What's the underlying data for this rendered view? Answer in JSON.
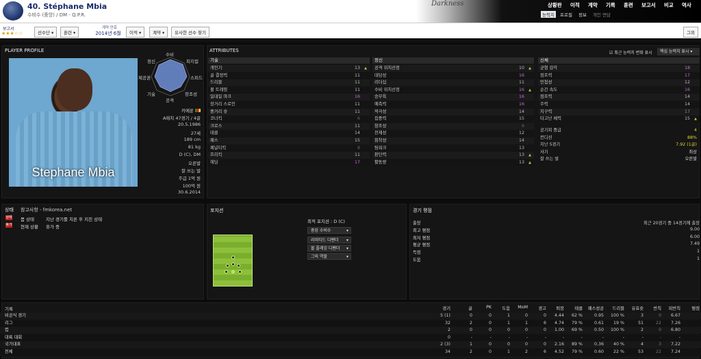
{
  "header": {
    "name": "40. Stéphane Mbia",
    "subtitle": "수비수 (중앙) / DM - Q.P.R.",
    "skin_name": "Darkness",
    "menu": [
      "상황판",
      "이적",
      "계약",
      "기록",
      "훈련",
      "보고서",
      "비교",
      "역사"
    ],
    "subtabs": [
      "능력치",
      "프로필",
      "정보",
      "개인 면담"
    ]
  },
  "toolbar": {
    "scout_label": "보고서",
    "stars": "★★★☆☆",
    "player_label": "선수단",
    "training_label": "훈련",
    "contract_label": "계약 만료",
    "contract_value": "2014년 6월",
    "transfer_label": "이적",
    "contract_btn": "계약",
    "similar_label": "유사한 선수 찾기",
    "other_label": "그외"
  },
  "profile": {
    "title": "PLAYER PROFILE",
    "photo_name": "Stephane Mbia",
    "radar_labels": [
      "수비",
      "피지컬",
      "스피드",
      "창조성",
      "공격",
      "기술",
      "제공권",
      "정신"
    ],
    "info": [
      "카메룬",
      "A매치 47경기 / 4골",
      "20.5.1986",
      "27세",
      "189 cm",
      "81 kg",
      "D (C), DM",
      "오른발",
      "잘 쓰는 발",
      "주급 1억 원",
      "100억 원",
      "30.6.2014"
    ]
  },
  "attributes": {
    "title": "ATTRIBUTES",
    "show_changes": "최근 능력치 변화 표시",
    "key_label": "핵심 능력치 표시",
    "technical": {
      "title": "기술",
      "rows": [
        [
          "개인기",
          "13",
          "▲"
        ],
        [
          "골 결정력",
          "11",
          ""
        ],
        [
          "드리블",
          "11",
          ""
        ],
        [
          "볼 트래핑",
          "11",
          ""
        ],
        [
          "일대일 마크",
          "16",
          ""
        ],
        [
          "장거리 스로인",
          "11",
          ""
        ],
        [
          "중거리 슛",
          "11",
          ""
        ],
        [
          "코너킥",
          "6",
          ""
        ],
        [
          "크로스",
          "11",
          ""
        ],
        [
          "태클",
          "14",
          ""
        ],
        [
          "패스",
          "15",
          ""
        ],
        [
          "페널티킥",
          "8",
          ""
        ],
        [
          "프리킥",
          "11",
          ""
        ],
        [
          "헤딩",
          "17",
          ""
        ]
      ]
    },
    "mental": {
      "title": "정신",
      "rows": [
        [
          "공격 위치선정",
          "10",
          "▲"
        ],
        [
          "대담성",
          "16",
          ""
        ],
        [
          "리더십",
          "11",
          ""
        ],
        [
          "수비 위치선정",
          "16",
          "▲"
        ],
        [
          "승부욕",
          "16",
          ""
        ],
        [
          "예측력",
          "16",
          ""
        ],
        [
          "적극성",
          "14",
          ""
        ],
        [
          "집중력",
          "15",
          ""
        ],
        [
          "창조성",
          "6",
          ""
        ],
        [
          "천재성",
          "12",
          ""
        ],
        [
          "침착성",
          "14",
          ""
        ],
        [
          "팀워크",
          "13",
          ""
        ],
        [
          "판단력",
          "13",
          "▲"
        ],
        [
          "활동량",
          "13",
          "▲"
        ]
      ]
    },
    "physical": {
      "title": "신체",
      "rows": [
        [
          "균형 감각",
          "18",
          ""
        ],
        [
          "점프력",
          "17",
          ""
        ],
        [
          "민첩성",
          "12",
          ""
        ],
        [
          "순간 속도",
          "16",
          ""
        ],
        [
          "점프력",
          "14",
          ""
        ],
        [
          "주력",
          "14",
          ""
        ],
        [
          "지구력",
          "17",
          ""
        ],
        [
          "타고난 체력",
          "15",
          "▲"
        ]
      ]
    },
    "extras": [
      [
        "공기피 중급",
        "4"
      ],
      [
        "컨디션",
        "88%"
      ],
      [
        "지난 5경기",
        "7.92 (1골)"
      ],
      [
        "사기",
        "최상"
      ],
      [
        "잘 쓰는 발",
        "오른발"
      ]
    ]
  },
  "status": {
    "title": "상태",
    "source": "참고사항 - fmkorea.net",
    "rows": [
      [
        "몸 상태",
        "지난 경기를 치른 후 지친 상태"
      ],
      [
        "현재 상황",
        "휴가 중"
      ]
    ],
    "badges": [
      "상태",
      "휴가"
    ]
  },
  "position": {
    "title": "포지션",
    "best": "최적 포지션 : D (C)",
    "roles": [
      "중앙 수비수",
      "리미티드 디펜더",
      "볼 플레잉 디펜더",
      "그외 역할"
    ]
  },
  "rating": {
    "title": "경기 평점",
    "header": "최근 20경기 중 14경기에 출장",
    "rows": [
      [
        "출장",
        ""
      ],
      [
        "최고 평점",
        "9.00"
      ],
      [
        "최저 평점",
        "6.00"
      ],
      [
        "평균 평점",
        "7.49"
      ],
      [
        "득점",
        "1"
      ],
      [
        "도움",
        "1"
      ]
    ]
  },
  "records": {
    "title": "기록",
    "cols": [
      "경기",
      "골",
      "PK",
      "도움",
      "MoM",
      "경고",
      "퇴장",
      "태클",
      "패스성공",
      "드리블",
      "유효슛",
      "반칙",
      "피반칙",
      "평점"
    ],
    "rows": [
      [
        "비공식 경기",
        "5 (1)",
        "0",
        "0",
        "1",
        "0",
        "0",
        "4.44",
        "62 %",
        "0.95",
        "100 %",
        "3",
        "0",
        "6.67"
      ],
      [
        "리그",
        "32",
        "2",
        "0",
        "1",
        "1",
        "6",
        "4.74",
        "79 %",
        "0.61",
        "19 %",
        "51",
        "22",
        "7.26"
      ],
      [
        "컵",
        "2",
        "0",
        "0",
        "0",
        "0",
        "0",
        "1.00",
        "69 %",
        "0.50",
        "100 %",
        "2",
        "0",
        "6.80"
      ],
      [
        "대륙 대회",
        "0",
        "-",
        "-",
        "-",
        "-",
        "-",
        "-",
        "-",
        "-",
        "-",
        "-",
        "-",
        "-"
      ],
      [
        "국가대표",
        "2 (3)",
        "1",
        "0",
        "0",
        "0",
        "0",
        "2.16",
        "89 %",
        "0.36",
        "40 %",
        "4",
        "3",
        "7.22"
      ],
      [
        "전체",
        "34",
        "2",
        "0",
        "1",
        "2",
        "6",
        "4.52",
        "79 %",
        "0.60",
        "22 %",
        "53",
        "22",
        "7.24"
      ]
    ]
  }
}
